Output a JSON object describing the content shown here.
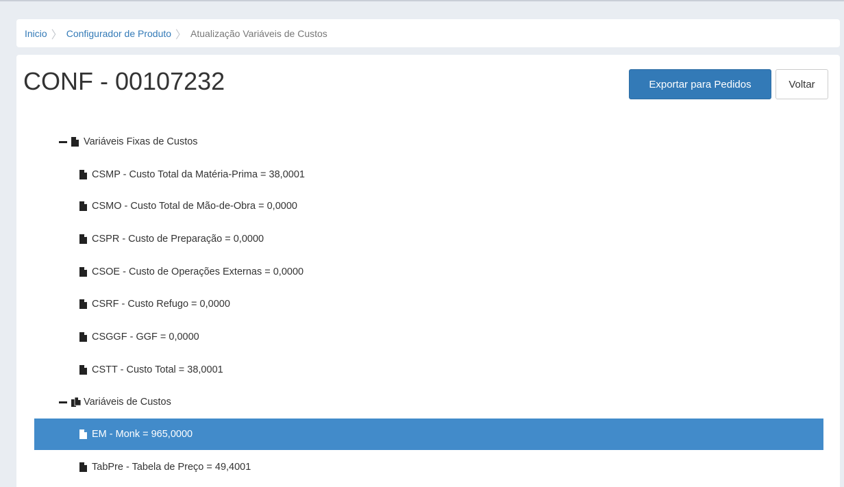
{
  "breadcrumb": {
    "items": [
      "Inicio",
      "Configurador de Produto"
    ],
    "current": "Atualização Variáveis de Custos"
  },
  "header": {
    "title": "CONF - 00107232",
    "export_label": "Exportar para Pedidos",
    "back_label": "Voltar"
  },
  "tree": {
    "group1": {
      "label": "Variáveis Fixas de Custos",
      "icon": "file-icon",
      "children": [
        "CSMP - Custo Total da Matéria-Prima = 38,0001",
        "CSMO - Custo Total de Mão-de-Obra = 0,0000",
        "CSPR - Custo de Preparação = 0,0000",
        "CSOE - Custo de Operações Externas = 0,0000",
        "CSRF - Custo Refugo = 0,0000",
        "CSGGF - GGF = 0,0000",
        "CSTT - Custo Total = 38,0001"
      ]
    },
    "group2": {
      "label": "Variáveis de Custos",
      "icon": "files-icon",
      "children": [
        "EM - Monk = 965,0000",
        "TabPre - Tabela de Preço = 49,4001"
      ],
      "selected_index": 0
    }
  },
  "colors": {
    "primary": "#337ab7",
    "selected_row": "#428bca",
    "link": "#337ab7",
    "background": "#e9edf2"
  }
}
